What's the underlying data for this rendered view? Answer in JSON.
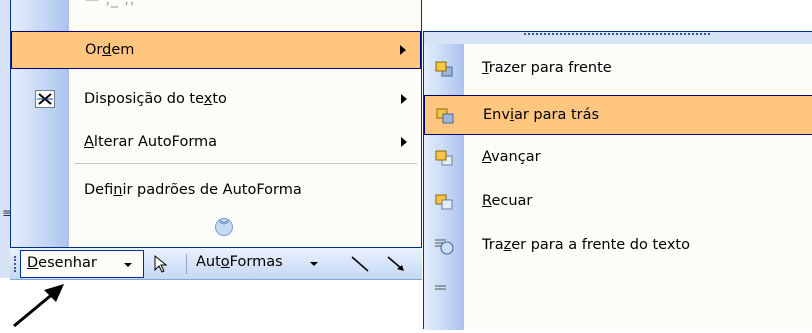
{
  "main_menu": {
    "items": [
      {
        "pre": "Or",
        "ul": "d",
        "post": "em"
      },
      {
        "pre": "Disposição do te",
        "ul": "x",
        "post": "to"
      },
      {
        "pre": "",
        "ul": "A",
        "post": "lterar AutoForma"
      },
      {
        "pre": "Defi",
        "ul": "n",
        "post": "ir padrões de AutoForma"
      }
    ],
    "expand_icon": "chevron-double-down-icon"
  },
  "submenu": {
    "items": [
      {
        "pre": "",
        "ul": "T",
        "post": "razer para frente",
        "icon": "bring-to-front-icon"
      },
      {
        "pre": "Env",
        "ul": "i",
        "post": "ar para trás",
        "icon": "send-to-back-icon"
      },
      {
        "pre": "",
        "ul": "A",
        "post": "vançar",
        "icon": "bring-forward-icon"
      },
      {
        "pre": "",
        "ul": "R",
        "post": "ecuar",
        "icon": "send-backward-icon"
      },
      {
        "pre": "Tra",
        "ul": "z",
        "post": "er para a frente do texto",
        "icon": "bring-in-front-of-text-icon"
      }
    ]
  },
  "toolbar": {
    "desenhar": {
      "pre": "",
      "ul": "D",
      "post": "esenhar"
    },
    "autoformas": {
      "pre": "Aut",
      "ul": "o",
      "post": "Formas"
    }
  },
  "colors": {
    "highlight": "#ffc680",
    "border": "#002d96",
    "gutter": "#c4d6f4"
  }
}
